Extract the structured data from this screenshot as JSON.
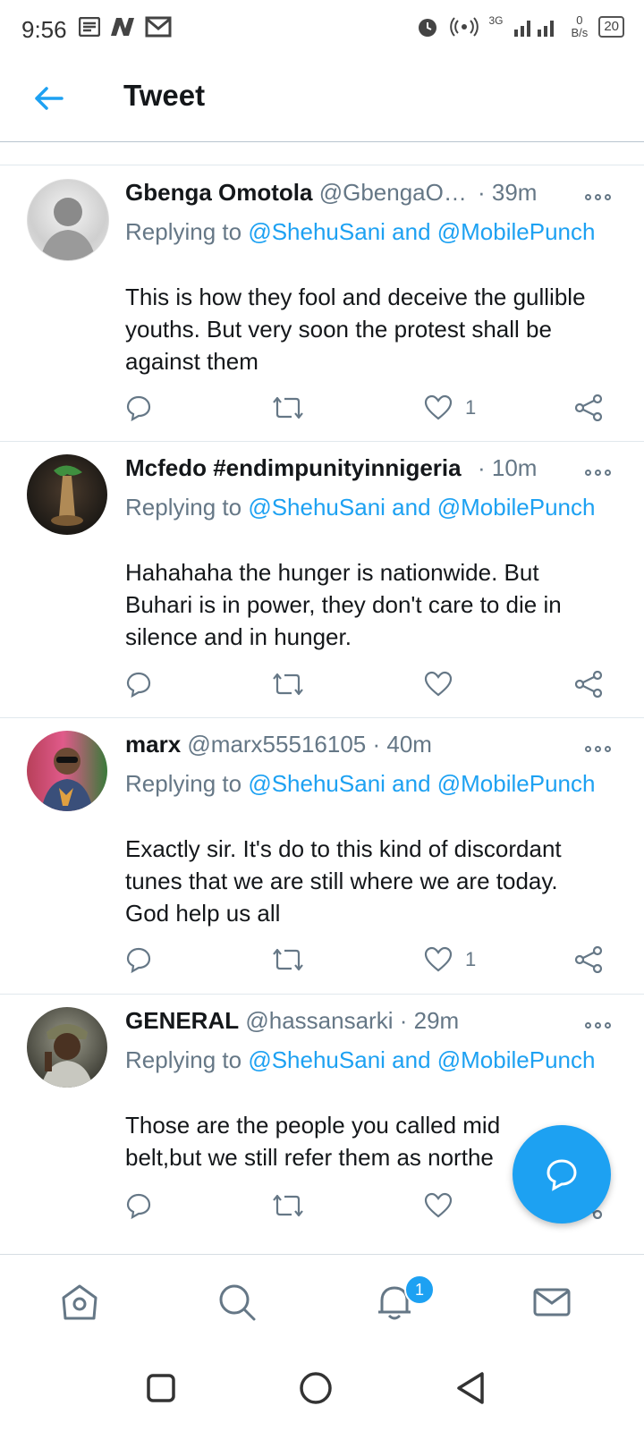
{
  "status_bar": {
    "time": "9:56",
    "battery": "20",
    "net_speed_top": "0",
    "net_speed_unit": "B/s",
    "network_type": "3G"
  },
  "header": {
    "title": "Tweet"
  },
  "tweets": [
    {
      "name": "Gbenga Omotola",
      "handle": "@GbengaO…",
      "time": "· 39m",
      "replying_prefix": "Replying to",
      "mentions": "@ShehuSani and @MobilePunch",
      "text": "This is how they fool and deceive the gullible youths. But very soon the protest shall be against them",
      "likes": "1"
    },
    {
      "name": "Mcfedo #endimpunityinnigeria",
      "handle": "",
      "time": "· 10m",
      "replying_prefix": "Replying to",
      "mentions": "@ShehuSani and @MobilePunch",
      "text": "Hahahaha the hunger is nationwide. But Buhari is in power, they don't care to die in silence and in hunger.",
      "likes": ""
    },
    {
      "name": "marx",
      "handle": "@marx55516105",
      "time": "· 40m",
      "replying_prefix": "Replying to",
      "mentions": "@ShehuSani and @MobilePunch",
      "text": "Exactly sir. It's do to this kind of discordant tunes that we are still where we are today. God help us all",
      "likes": "1"
    },
    {
      "name": "GENERAL",
      "handle": "@hassansarki",
      "time": "· 29m",
      "replying_prefix": "Replying to",
      "mentions": "@ShehuSani and @MobilePunch",
      "text": "Those are the people you called mid belt,but we still refer them as northe",
      "likes": ""
    }
  ],
  "bottom_nav": {
    "notification_count": "1"
  },
  "icons": {
    "back": "arrow-left-icon",
    "more": "more-dots-icon",
    "reply": "reply-bubble-icon",
    "retweet": "retweet-icon",
    "like": "heart-icon",
    "share": "share-icon",
    "compose": "compose-reply-icon",
    "home": "home-icon",
    "search": "search-icon",
    "notifications": "bell-icon",
    "messages": "mail-icon"
  },
  "colors": {
    "accent": "#1da1f2",
    "text": "#14171a",
    "secondary": "#657786"
  }
}
